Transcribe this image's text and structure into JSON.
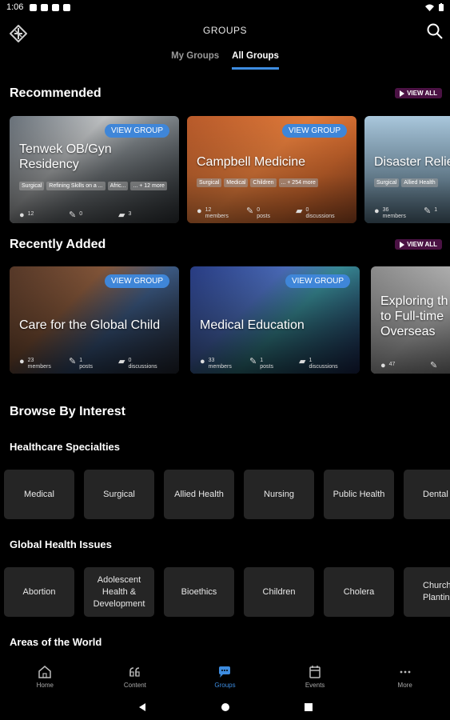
{
  "status": {
    "time": "1:06"
  },
  "header": {
    "title": "GROUPS"
  },
  "tabs": [
    {
      "label": "My Groups",
      "active": false
    },
    {
      "label": "All Groups",
      "active": true
    }
  ],
  "recommended": {
    "title": "Recommended",
    "view_all": "VIEW ALL",
    "cards": [
      {
        "title": "Tenwek OB/Gyn Residency",
        "button": "VIEW GROUP",
        "tags": [
          "Surgical",
          "Refining Skills on a ...",
          "Afric...",
          "... + 12 more"
        ],
        "stats": [
          {
            "value": "12",
            "label": ""
          },
          {
            "value": "0",
            "label": ""
          },
          {
            "value": "3",
            "label": ""
          }
        ]
      },
      {
        "title": "Campbell Medicine",
        "button": "VIEW GROUP",
        "tags": [
          "Surgical",
          "Medical",
          "Children",
          "... + 254 more"
        ],
        "stats": [
          {
            "value": "12",
            "label": "members"
          },
          {
            "value": "0",
            "label": "posts"
          },
          {
            "value": "0",
            "label": "discussions"
          }
        ]
      },
      {
        "title": "Disaster Relie",
        "button": "",
        "tags": [
          "Surgical",
          "Allied Health"
        ],
        "stats": [
          {
            "value": "36",
            "label": "members"
          },
          {
            "value": "1",
            "label": ""
          }
        ]
      }
    ]
  },
  "recently_added": {
    "title": "Recently Added",
    "view_all": "VIEW ALL",
    "cards": [
      {
        "title": "Care for the Global Child",
        "button": "VIEW GROUP",
        "stats": [
          {
            "value": "23",
            "label": "members"
          },
          {
            "value": "1",
            "label": "posts"
          },
          {
            "value": "0",
            "label": "discussions"
          }
        ]
      },
      {
        "title": "Medical Education",
        "button": "VIEW GROUP",
        "stats": [
          {
            "value": "33",
            "label": "members"
          },
          {
            "value": "1",
            "label": "posts"
          },
          {
            "value": "1",
            "label": "discussions"
          }
        ]
      },
      {
        "title": "Exploring th to Full-time Overseas",
        "button": "",
        "stats": [
          {
            "value": "47",
            "label": ""
          }
        ]
      }
    ]
  },
  "browse": {
    "title": "Browse By Interest",
    "specialties": {
      "title": "Healthcare Specialties",
      "items": [
        "Medical",
        "Surgical",
        "Allied Health",
        "Nursing",
        "Public Health",
        "Dental"
      ]
    },
    "issues": {
      "title": "Global Health Issues",
      "items": [
        "Abortion",
        "Adolescent Health & Development",
        "Bioethics",
        "Children",
        "Cholera",
        "Church Planting"
      ]
    },
    "areas": {
      "title": "Areas of the World"
    }
  },
  "bottom_nav": [
    {
      "label": "Home",
      "icon": "home-icon"
    },
    {
      "label": "Content",
      "icon": "quote-icon"
    },
    {
      "label": "Groups",
      "icon": "chat-icon",
      "active": true
    },
    {
      "label": "Events",
      "icon": "calendar-icon"
    },
    {
      "label": "More",
      "icon": "more-icon"
    }
  ],
  "colors": {
    "accent": "#3d8ce0",
    "view_all_bg": "#4b1244",
    "chip_bg": "#252525"
  }
}
